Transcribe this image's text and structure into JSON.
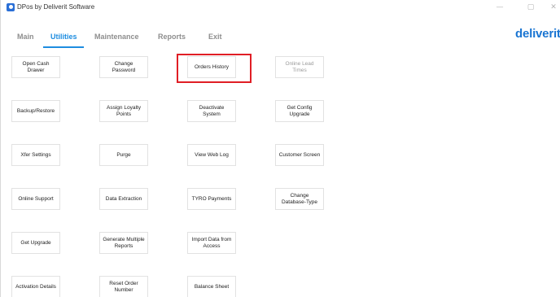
{
  "window": {
    "title": "DPos by Deliverit Software",
    "controls": {
      "minimize": "—",
      "maximize": "▢",
      "close": "✕"
    }
  },
  "tabs": [
    {
      "label": "Main",
      "active": false
    },
    {
      "label": "Utilities",
      "active": true
    },
    {
      "label": "Maintenance",
      "active": false
    },
    {
      "label": "Reports",
      "active": false
    },
    {
      "label": "Exit",
      "active": false
    }
  ],
  "brand": {
    "logo_text": "deliverit",
    "logo_sub": ""
  },
  "colors": {
    "accent": "#1e8de0",
    "highlight": "#e01e25",
    "logo": "#1a75d2"
  },
  "buttons": [
    {
      "label": "Open Cash\nDrawer"
    },
    {
      "label": "Change Password"
    },
    {
      "label": "Orders History",
      "highlighted": true
    },
    {
      "label": "Online Lead\nTimes",
      "disabled": true
    },
    {
      "label": "Backup/Restore"
    },
    {
      "label": "Assign Loyalty\nPoints"
    },
    {
      "label": "Deactivate\nSystem"
    },
    {
      "label": "Get Config\nUpgrade"
    },
    {
      "label": "Xfer Settings"
    },
    {
      "label": "Purge"
    },
    {
      "label": "View Web Log"
    },
    {
      "label": "Customer Screen"
    },
    {
      "label": "Online Support"
    },
    {
      "label": "Data Extraction"
    },
    {
      "label": "TYRO Payments"
    },
    {
      "label": "Change\nDatabase-Type"
    },
    {
      "label": "Get Upgrade"
    },
    {
      "label": "Generate Multiple\nReports"
    },
    {
      "label": "Import Data from\nAccess"
    },
    {
      "label": "Activation Details"
    },
    {
      "label": "Reset Order\nNumber"
    },
    {
      "label": "Balance Sheet"
    }
  ]
}
